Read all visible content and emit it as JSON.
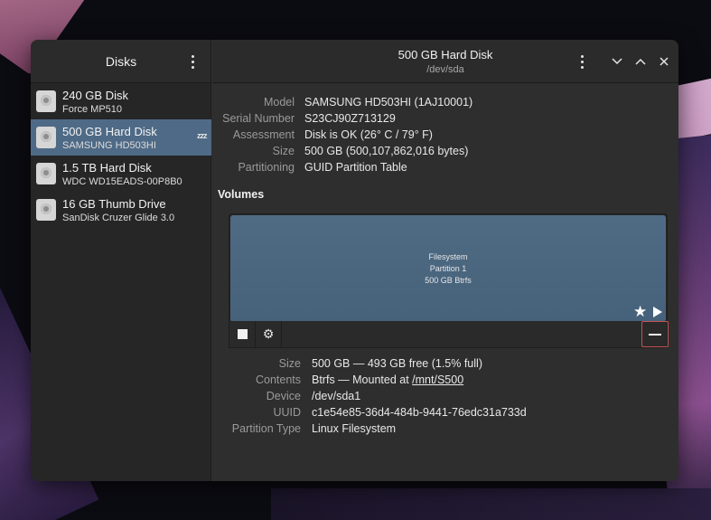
{
  "sidebar": {
    "title": "Disks",
    "menu_icon": "kebab-menu-icon",
    "disks": [
      {
        "name": "240 GB Disk",
        "model": "Force MP510",
        "icon": "hard-disk-icon"
      },
      {
        "name": "500 GB Hard Disk",
        "model": "SAMSUNG HD503HI",
        "icon": "hard-disk-icon",
        "selected": true,
        "status": "zzz"
      },
      {
        "name": "1.5 TB Hard Disk",
        "model": "WDC WD15EADS-00P8B0",
        "icon": "hard-disk-icon"
      },
      {
        "name": "16 GB Thumb Drive",
        "model": "SanDisk Cruzer Glide 3.0",
        "icon": "hard-disk-icon"
      }
    ]
  },
  "header": {
    "title": "500 GB Hard Disk",
    "subtitle": "/dev/sda"
  },
  "disk_info": [
    {
      "label": "Model",
      "value": "SAMSUNG HD503HI (1AJ10001)"
    },
    {
      "label": "Serial Number",
      "value": "S23CJ90Z713129"
    },
    {
      "label": "Assessment",
      "value": "Disk is OK (26° C / 79° F)"
    },
    {
      "label": "Size",
      "value": "500 GB (500,107,862,016 bytes)"
    },
    {
      "label": "Partitioning",
      "value": "GUID Partition Table"
    }
  ],
  "volumes": {
    "title": "Volumes",
    "partition": {
      "line1": "Filesystem",
      "line2": "Partition 1",
      "line3": "500 GB Btrfs"
    }
  },
  "volume_info": [
    {
      "label": "Size",
      "value": "500 GB — 493 GB free (1.5% full)"
    },
    {
      "label": "Contents",
      "value": "Btrfs — Mounted at ",
      "link": "/mnt/S500"
    },
    {
      "label": "Device",
      "value": "/dev/sda1"
    },
    {
      "label": "UUID",
      "value": "c1e54e85-36d4-484b-9441-76edc31a733d"
    },
    {
      "label": "Partition Type",
      "value": "Linux Filesystem"
    }
  ],
  "colors": {
    "selection": "#4e6a86",
    "partition": "#4f6b84",
    "remove_border": "#c25252"
  }
}
